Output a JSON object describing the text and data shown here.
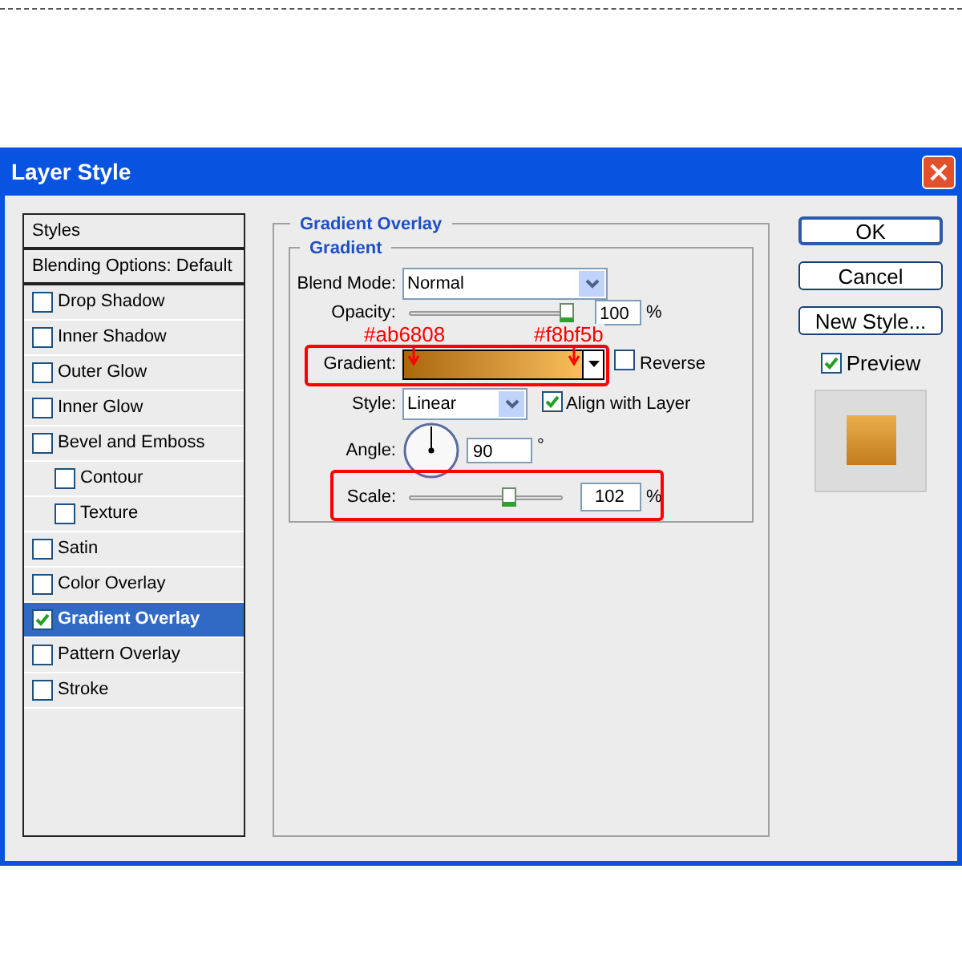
{
  "window": {
    "title": "Layer Style"
  },
  "styles": [
    {
      "kind": "header",
      "label": "Styles",
      "selected": false
    },
    {
      "kind": "header",
      "label": "Blending Options: Default",
      "selected": false
    },
    {
      "kind": "effect",
      "label": "Drop Shadow",
      "checked": false,
      "selected": false
    },
    {
      "kind": "effect",
      "label": "Inner Shadow",
      "checked": false,
      "selected": false
    },
    {
      "kind": "effect",
      "label": "Outer Glow",
      "checked": false,
      "selected": false
    },
    {
      "kind": "effect",
      "label": "Inner Glow",
      "checked": false,
      "selected": false
    },
    {
      "kind": "effect",
      "label": "Bevel and Emboss",
      "checked": false,
      "selected": false,
      "children": [
        {
          "kind": "effect",
          "label": "Contour",
          "checked": false,
          "selected": false
        },
        {
          "kind": "effect",
          "label": "Texture",
          "checked": false,
          "selected": false
        }
      ]
    },
    {
      "kind": "effect",
      "label": "Satin",
      "checked": false,
      "selected": false
    },
    {
      "kind": "effect",
      "label": "Color Overlay",
      "checked": false,
      "selected": false
    },
    {
      "kind": "effect",
      "label": "Gradient Overlay",
      "checked": true,
      "selected": true
    },
    {
      "kind": "effect",
      "label": "Pattern Overlay",
      "checked": false,
      "selected": false
    },
    {
      "kind": "effect",
      "label": "Stroke",
      "checked": false,
      "selected": false
    }
  ],
  "panel": {
    "title": "Gradient Overlay",
    "group_title": "Gradient",
    "blend_mode": {
      "label": "Blend Mode:",
      "value": "Normal"
    },
    "opacity": {
      "label": "Opacity:",
      "value": "100",
      "unit": "%",
      "level": 0.97
    },
    "gradient": {
      "label": "Gradient:"
    },
    "reverse": {
      "label": "Reverse",
      "checked": false
    },
    "style": {
      "label": "Style:",
      "value": "Linear"
    },
    "align": {
      "label": "Align with Layer",
      "checked": true
    },
    "angle": {
      "label": "Angle:",
      "value": "90",
      "unit": "°"
    },
    "scale": {
      "label": "Scale:",
      "value": "102",
      "unit": "%",
      "level": 0.66
    }
  },
  "buttons": [
    {
      "label": "OK",
      "default": true
    },
    {
      "label": "Cancel",
      "default": false
    },
    {
      "label": "New Style...",
      "default": false
    }
  ],
  "preview": {
    "label": "Preview",
    "checked": true
  },
  "annotations": [
    {
      "text": "#ab6808"
    },
    {
      "text": "#f8bf5b"
    }
  ]
}
